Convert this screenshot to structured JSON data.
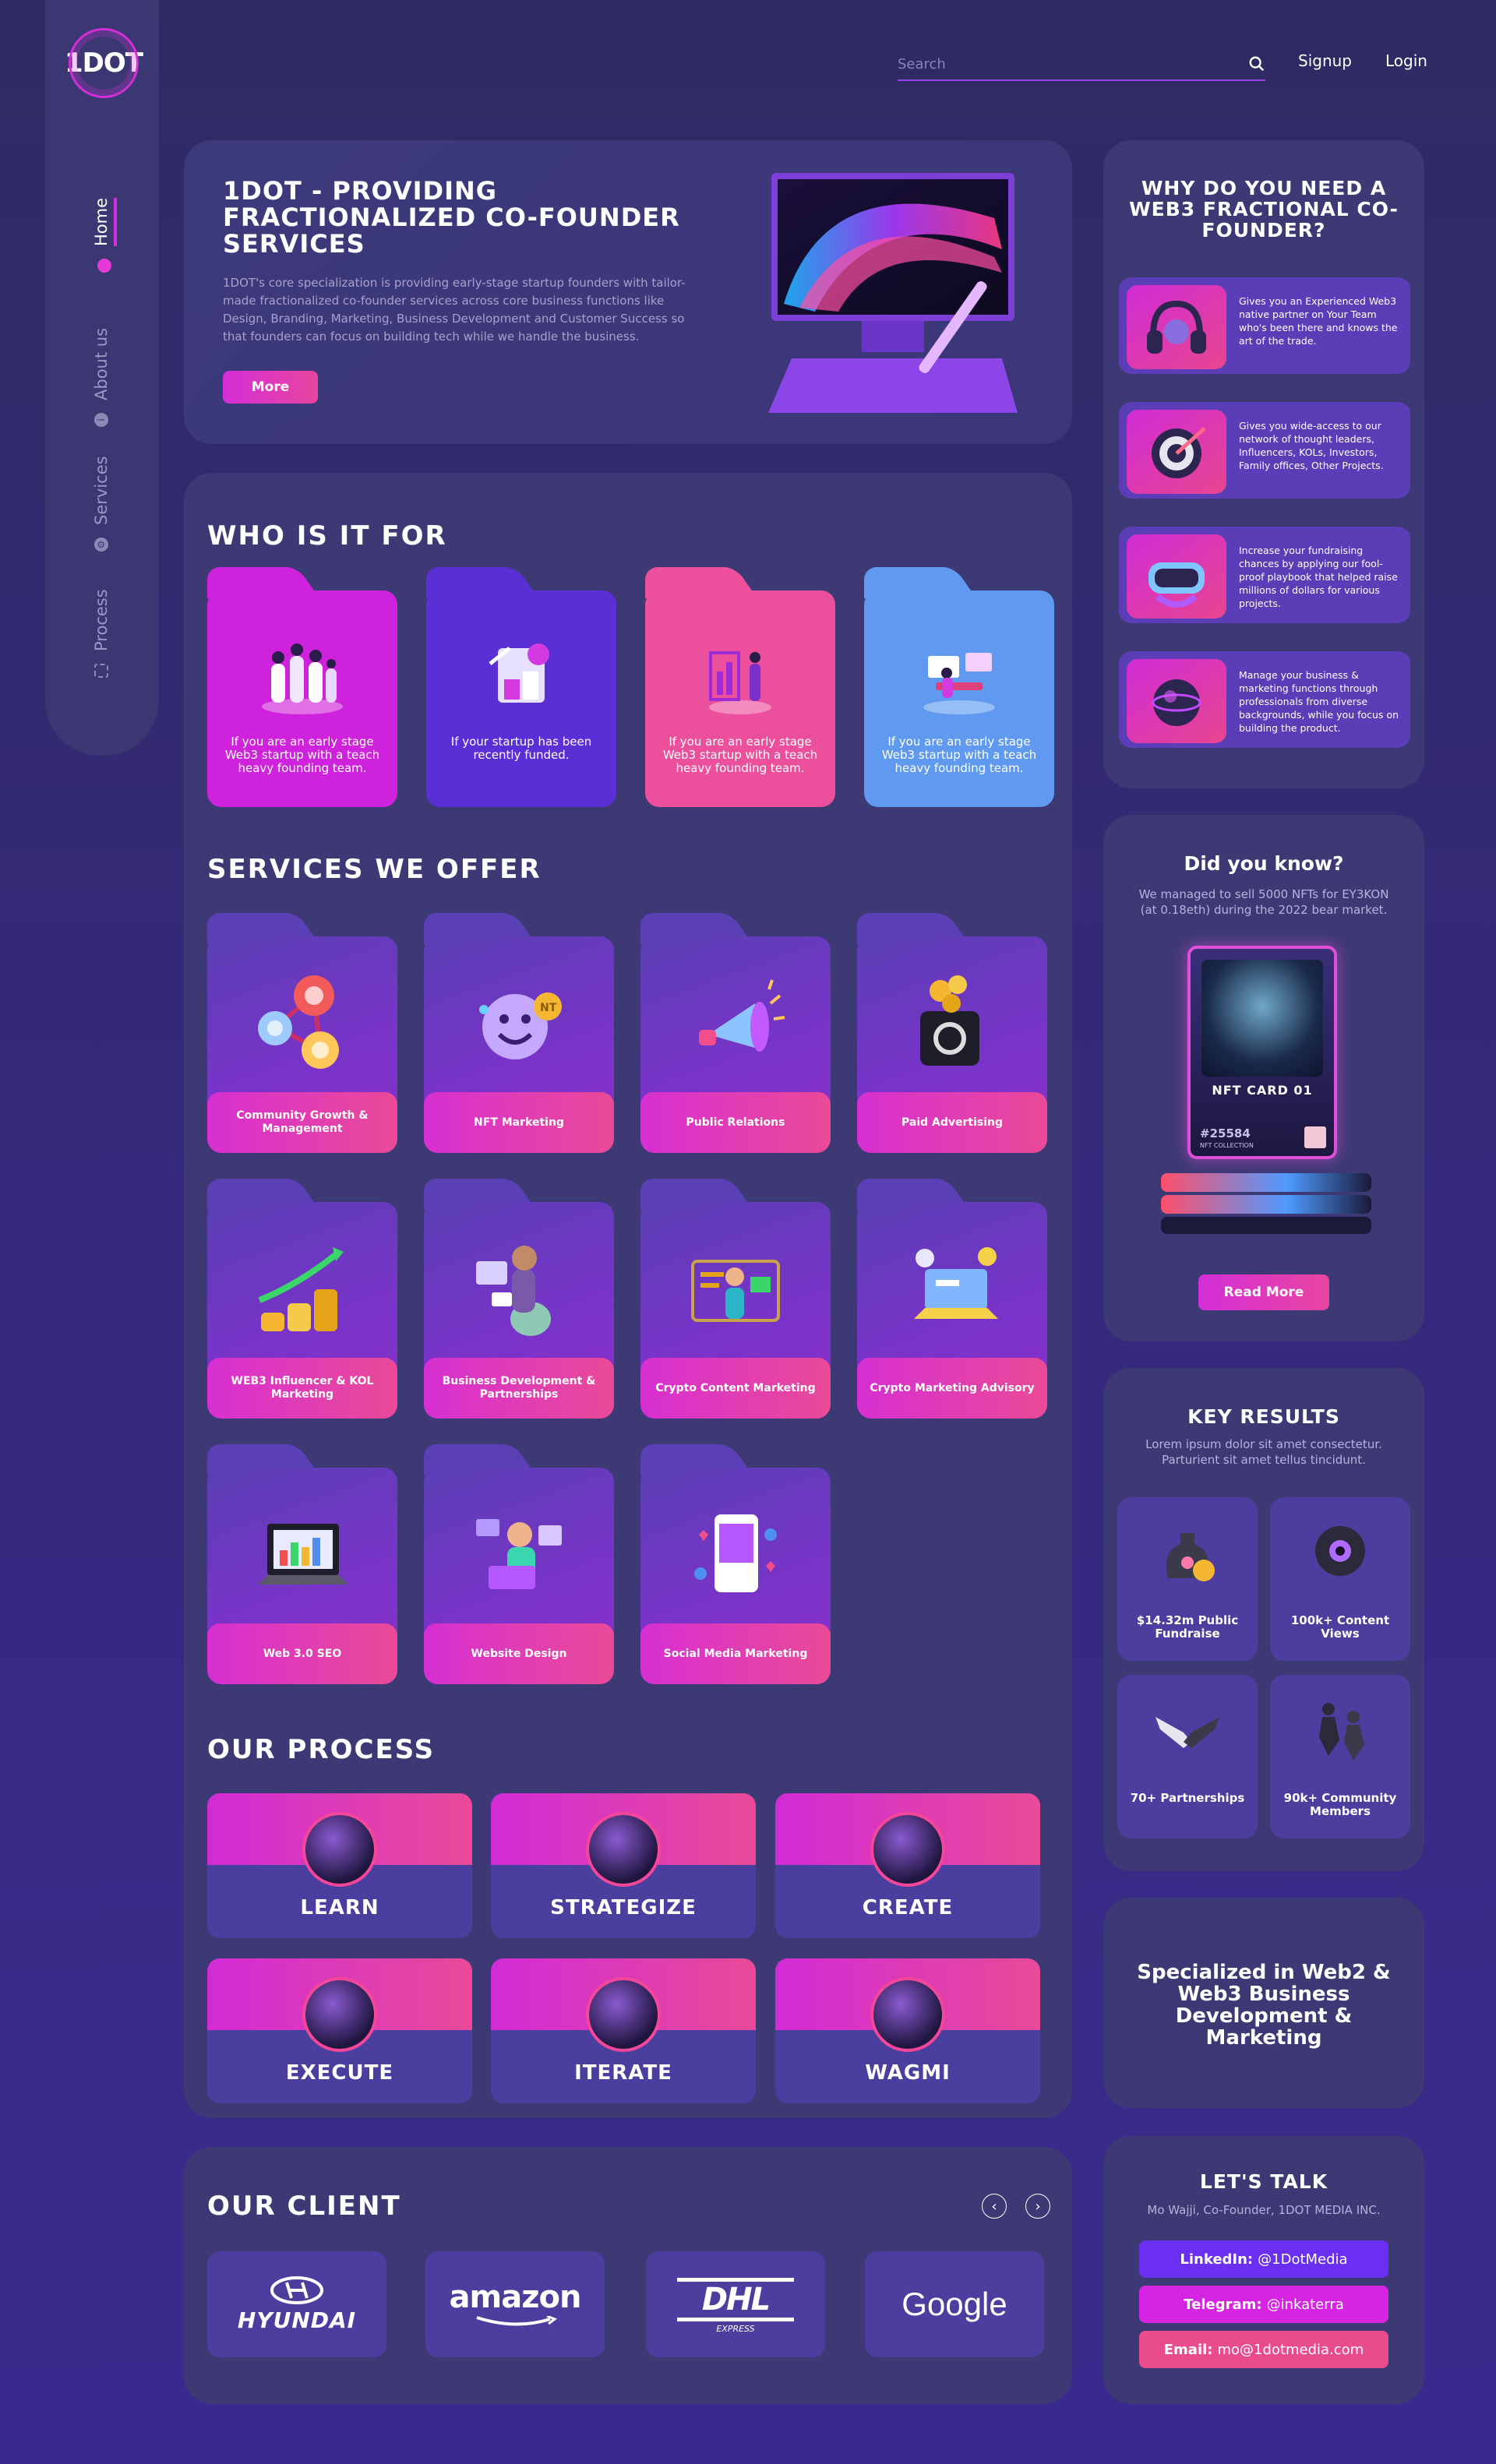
{
  "brand": {
    "logo": "1DOT"
  },
  "nav": {
    "items": [
      {
        "label": "Home",
        "icon": "home-icon"
      },
      {
        "label": "About us",
        "icon": "info-icon"
      },
      {
        "label": "Services",
        "icon": "gears-icon"
      },
      {
        "label": "Process",
        "icon": "process-icon"
      }
    ]
  },
  "header": {
    "search_placeholder": "Search",
    "signup": "Signup",
    "login": "Login"
  },
  "hero": {
    "title": "1DOT - PROVIDING FRACTIONALIZED CO-FOUNDER SERVICES",
    "description": "1DOT's core specialization is providing early-stage startup founders with tailor-made fractionalized co-founder services across core business functions like Design, Branding, Marketing, Business Development and Customer Success so that founders can focus on building tech while we handle the business.",
    "button": "More"
  },
  "who": {
    "heading": "WHO IS IT FOR",
    "cards": [
      {
        "text": "If you are an early stage Web3 startup with a teach heavy founding team.",
        "color": "#cf22dc"
      },
      {
        "text": "If your startup has been recently funded.",
        "color": "#5a2fd6"
      },
      {
        "text": "If you are an early stage Web3 startup with a teach heavy founding team.",
        "color": "#ec4f9b"
      },
      {
        "text": "If you are an early stage Web3 startup with a teach heavy founding team.",
        "color": "#5f9af0"
      }
    ]
  },
  "services": {
    "heading": "SERVICES WE OFFER",
    "items": [
      "Community Growth & Management",
      "NFT Marketing",
      "Public Relations",
      "Paid Advertising",
      "WEB3 Influencer & KOL Marketing",
      "Business Development & Partnerships",
      "Crypto Content Marketing",
      "Crypto Marketing Advisory",
      "Web 3.0 SEO",
      "Website Design",
      "Social Media Marketing"
    ]
  },
  "process": {
    "heading": "OUR PROCESS",
    "steps": [
      "LEARN",
      "STRATEGIZE",
      "CREATE",
      "EXECUTE",
      "ITERATE",
      "WAGMI"
    ]
  },
  "clients": {
    "heading": "OUR CLIENT",
    "logos": [
      "HYUNDAI",
      "amazon",
      "DHL",
      "Google"
    ],
    "dhl_sub": "EXPRESS",
    "prev": "‹",
    "next": "›"
  },
  "why": {
    "heading": "WHY DO YOU NEED A WEB3 FRACTIONAL CO-FOUNDER?",
    "reasons": [
      "Gives you an Experienced Web3 native partner on Your Team who's been there and knows the art of the trade.",
      "Gives you wide-access to our network of thought leaders, Influencers, KOLs, Investors, Family offices, Other Projects.",
      "Increase your fundraising chances by applying our fool-proof playbook that helped raise millions of dollars for various projects.",
      "Manage your business & marketing functions through professionals from diverse backgrounds, while you focus on building the product."
    ]
  },
  "didyouknow": {
    "heading": "Did you know?",
    "text": "We managed to sell 5000 NFTs for EY3KON (at 0.18eth) during the 2022 bear market.",
    "card_title": "NFT CARD 01",
    "card_number": "#25584",
    "card_sub": "NFT COLLECTION",
    "button": "Read More"
  },
  "keyresults": {
    "heading": "KEY RESULTS",
    "text": "Lorem ipsum dolor sit amet consectetur. Parturient sit amet tellus tincidunt.",
    "items": [
      "$14.32m Public Fundraise",
      "100k+ Content Views",
      "70+ Partnerships",
      "90k+ Community Members"
    ]
  },
  "specialized": {
    "text": "Specialized in Web2 & Web3 Business Development & Marketing"
  },
  "talk": {
    "heading": "LET'S TALK",
    "sub": "Mo Wajji, Co-Founder, 1DOT MEDIA INC.",
    "linkedin_label": "LinkedIn:",
    "linkedin_value": "@1DotMedia",
    "telegram_label": "Telegram:",
    "telegram_value": "@inkaterra",
    "email_label": "Email:",
    "email_value": "mo@1dotmedia.com"
  },
  "colors": {
    "accent": "#d42ed8",
    "pink": "#ea4a98",
    "panel": "#3d3975",
    "bg": "#2e2b63"
  }
}
